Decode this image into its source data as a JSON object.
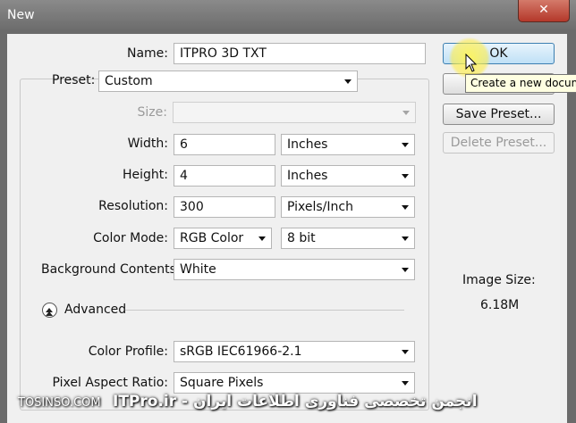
{
  "window": {
    "title": "New",
    "close_label": "✕"
  },
  "form": {
    "name_label": "Name:",
    "name_value": "ITPRO 3D TXT",
    "preset_label": "Preset:",
    "preset_value": "Custom",
    "size_label": "Size:",
    "size_value": "",
    "width_label": "Width:",
    "width_value": "6",
    "width_unit": "Inches",
    "height_label": "Height:",
    "height_value": "4",
    "height_unit": "Inches",
    "resolution_label": "Resolution:",
    "resolution_value": "300",
    "resolution_unit": "Pixels/Inch",
    "color_mode_label": "Color Mode:",
    "color_mode_value": "RGB Color",
    "bit_depth_value": "8 bit",
    "background_label": "Background Contents:",
    "background_value": "White",
    "advanced_label": "Advanced",
    "color_profile_label": "Color Profile:",
    "color_profile_value": "sRGB IEC61966-2.1",
    "pixel_aspect_label": "Pixel Aspect Ratio:",
    "pixel_aspect_value": "Square Pixels"
  },
  "buttons": {
    "ok": "OK",
    "cancel": "",
    "save_preset": "Save Preset...",
    "delete_preset": "Delete Preset..."
  },
  "tooltip": "Create a new document",
  "image_size": {
    "label": "Image Size:",
    "value": "6.18M"
  },
  "watermark": {
    "site": "TOSINSO.COM",
    "text": "ITPro.ir - انجمن تخصصی فناوری اطلاعات ایران"
  },
  "colors": {
    "accent": "#3c7fb1",
    "close": "#b4382a",
    "highlight": "#ffec3c"
  }
}
